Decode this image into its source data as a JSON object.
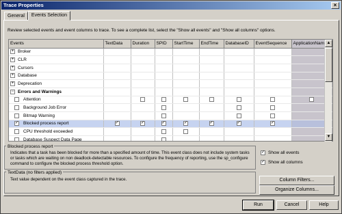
{
  "window": {
    "title": "Trace Properties",
    "close_glyph": "×"
  },
  "tabs": [
    {
      "label": "General"
    },
    {
      "label": "Events Selection"
    }
  ],
  "intro": "Review selected events and event columns to trace. To see a complete list, select the \"Show all events\" and \"Show all columns\" options.",
  "grid": {
    "columns": [
      "Events",
      "TextData",
      "Duration",
      "SPID",
      "StartTime",
      "EndTime",
      "DatabaseID",
      "EventSequence",
      "ApplicationName"
    ],
    "rows": [
      {
        "label": "Broker",
        "kind": "category",
        "exp": "+",
        "checks": []
      },
      {
        "label": "CLR",
        "kind": "category",
        "exp": "+",
        "checks": []
      },
      {
        "label": "Cursors",
        "kind": "category",
        "exp": "+",
        "checks": []
      },
      {
        "label": "Database",
        "kind": "category",
        "exp": "+",
        "checks": []
      },
      {
        "label": "Deprecation",
        "kind": "category",
        "exp": "+",
        "checks": []
      },
      {
        "label": "Errors and Warnings",
        "kind": "group",
        "exp": "−",
        "checks": []
      },
      {
        "label": "Attention",
        "kind": "event",
        "checks": [
          "",
          "empty",
          "empty",
          "empty",
          "empty",
          "empty",
          "empty",
          "empty"
        ]
      },
      {
        "label": "Background Job Error",
        "kind": "event",
        "checks": [
          "",
          "",
          "empty",
          "",
          "",
          "empty",
          "empty",
          ""
        ]
      },
      {
        "label": "Bitmap Warning",
        "kind": "event",
        "checks": [
          "",
          "",
          "empty",
          "",
          "",
          "empty",
          "empty",
          ""
        ]
      },
      {
        "label": "Blocked process report",
        "kind": "event",
        "selected": true,
        "checks": [
          "on",
          "on",
          "on",
          "on",
          "on",
          "on",
          "on",
          ""
        ]
      },
      {
        "label": "CPU threshold exceeded",
        "kind": "event",
        "checks": [
          "",
          "",
          "empty",
          "empty",
          "",
          "",
          "",
          ""
        ]
      },
      {
        "label": "Database Suspect Data Page",
        "kind": "event",
        "checks": [
          "",
          "",
          "empty",
          "",
          "",
          "",
          "",
          ""
        ]
      }
    ]
  },
  "description": {
    "title": "Blocked process report",
    "text": "Indicates that a task has been blocked for more than a specified amount of time. This event class does not include system tasks or tasks which are waiting on non deadlock-detectable resources. To configure the frequency of reporting, use the sp_configure command to configure the blocked process threshold option."
  },
  "column_info": {
    "title": "TextData (no filters applied)",
    "text": "Text value dependent on the event class captured in the trace."
  },
  "options": {
    "show_all_events": {
      "label": "Show all events",
      "checked": true
    },
    "show_all_columns": {
      "label": "Show all columns",
      "checked": true
    }
  },
  "buttons": {
    "column_filters": "Column Filters...",
    "organize_columns": "Organize Columns...",
    "run": "Run",
    "cancel": "Cancel",
    "help": "Help"
  },
  "colors": {
    "title_bar_start": "#0a246a",
    "title_bar_end": "#a6caf0",
    "selected_row": "#c6d3f0"
  }
}
